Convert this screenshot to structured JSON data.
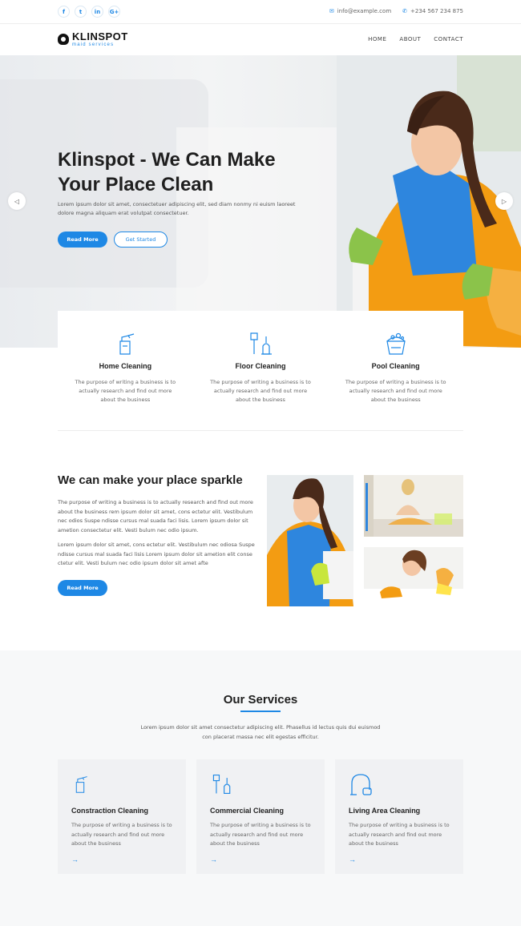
{
  "colors": {
    "accent": "#1e88e5",
    "text": "#1f1f1f",
    "muted": "#666666"
  },
  "topbar": {
    "socials": [
      {
        "icon": "facebook-icon",
        "glyph": "f"
      },
      {
        "icon": "twitter-icon",
        "glyph": "t"
      },
      {
        "icon": "linkedin-icon",
        "glyph": "in"
      },
      {
        "icon": "google-plus-icon",
        "glyph": "G+"
      }
    ],
    "email": "info@example.com",
    "phone": "+234 567 234 875"
  },
  "header": {
    "logo_title": "KLINSPOT",
    "logo_sub": "maid services",
    "nav": [
      "HOME",
      "ABOUT",
      "CONTACT"
    ]
  },
  "hero": {
    "title": "Klinspot - We Can Make Your Place Clean",
    "lead": "Lorem ipsum dolor sit amet, consectetuer adipiscing elit, sed diam nonmy ni euism laoreet dolore magna aliquam erat volutpat consectetuer.",
    "btn_primary": "Read More",
    "btn_secondary": "Get Started",
    "prev": "◁",
    "next": "▷"
  },
  "features": [
    {
      "icon": "spray-bottle-icon",
      "title": "Home Cleaning",
      "text": "The purpose of writing a business is to actually research and find out more about the business"
    },
    {
      "icon": "broom-icon",
      "title": "Floor Cleaning",
      "text": "The purpose of writing a business is to actually research and find out more about the business"
    },
    {
      "icon": "bucket-icon",
      "title": "Pool Cleaning",
      "text": "The purpose of writing a business is to actually research and find out more about the business"
    }
  ],
  "about": {
    "title": "We can make your place sparkle",
    "p1": "The purpose of writing a business is to actually research and find out more about the business rem ipsum dolor sit amet, cons ectetur elit. Vestibulum nec odios Suspe ndisse cursus mal suada faci lisis. Lorem ipsum dolor sit ametion consectetur elit. Vesti bulum nec odio ipsum.",
    "p2": "Lorem ipsum dolor sit amet, cons ectetur elit. Vestibulum nec odiosa Suspe ndisse cursus mal suada faci lisis Lorem ipsum dolor sit ametion elit conse ctetur elit. Vesti bulum nec odio ipsum dolor sit amet afte",
    "btn": "Read More"
  },
  "services": {
    "title": "Our Services",
    "sub": "Lorem ipsum dolor sit amet consectetur adipiscing elit. Phasellus id lectus quis dui euismod con placerat massa nec elit egestas efficitur.",
    "cards": [
      {
        "icon": "spray-bottle-icon",
        "title": "Constraction Cleaning",
        "text": "The purpose of writing a business is to actually research and find out more about the business",
        "arrow": "→"
      },
      {
        "icon": "broom-icon",
        "title": "Commercial Cleaning",
        "text": "The purpose of writing a business is to actually research and find out more about the business",
        "arrow": "→"
      },
      {
        "icon": "vacuum-icon",
        "title": "Living Area Cleaning",
        "text": "The purpose of writing a business is to actually research and find out more about the business",
        "arrow": "→"
      }
    ]
  }
}
